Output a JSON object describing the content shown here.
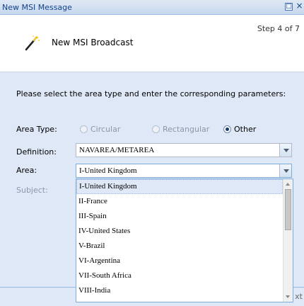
{
  "window": {
    "title": "New MSI Message",
    "maximize_glyph": "□",
    "close_glyph": "×"
  },
  "header": {
    "step": "Step 4 of 7",
    "title": "New MSI Broadcast",
    "icon": "magic-wand-icon"
  },
  "form": {
    "instruction": "Please select the area type and enter the corresponding parameters:",
    "area_type_label": "Area Type:",
    "area_types": [
      {
        "label": "Circular",
        "checked": false,
        "enabled": false
      },
      {
        "label": "Rectangular",
        "checked": false,
        "enabled": false
      },
      {
        "label": "Other",
        "checked": true,
        "enabled": true
      }
    ],
    "definition_label": "Definition:",
    "definition_value": "NAVAREA/METAREA",
    "area_label": "Area:",
    "area_value": "I-United Kingdom",
    "subject_label": "Subject:"
  },
  "dropdown": {
    "items": [
      "I-United Kingdom",
      "II-France",
      "III-Spain",
      "IV-United States",
      "V-Brazil",
      "VI-Argentina",
      "VII-South Africa",
      "VIII-India"
    ],
    "selected_index": 0
  },
  "footer": {
    "next_label_partial": "xt"
  },
  "colors": {
    "panel_bg": "#dfe8f6",
    "title_text": "#15428b",
    "focus_border": "#7eadd9"
  }
}
